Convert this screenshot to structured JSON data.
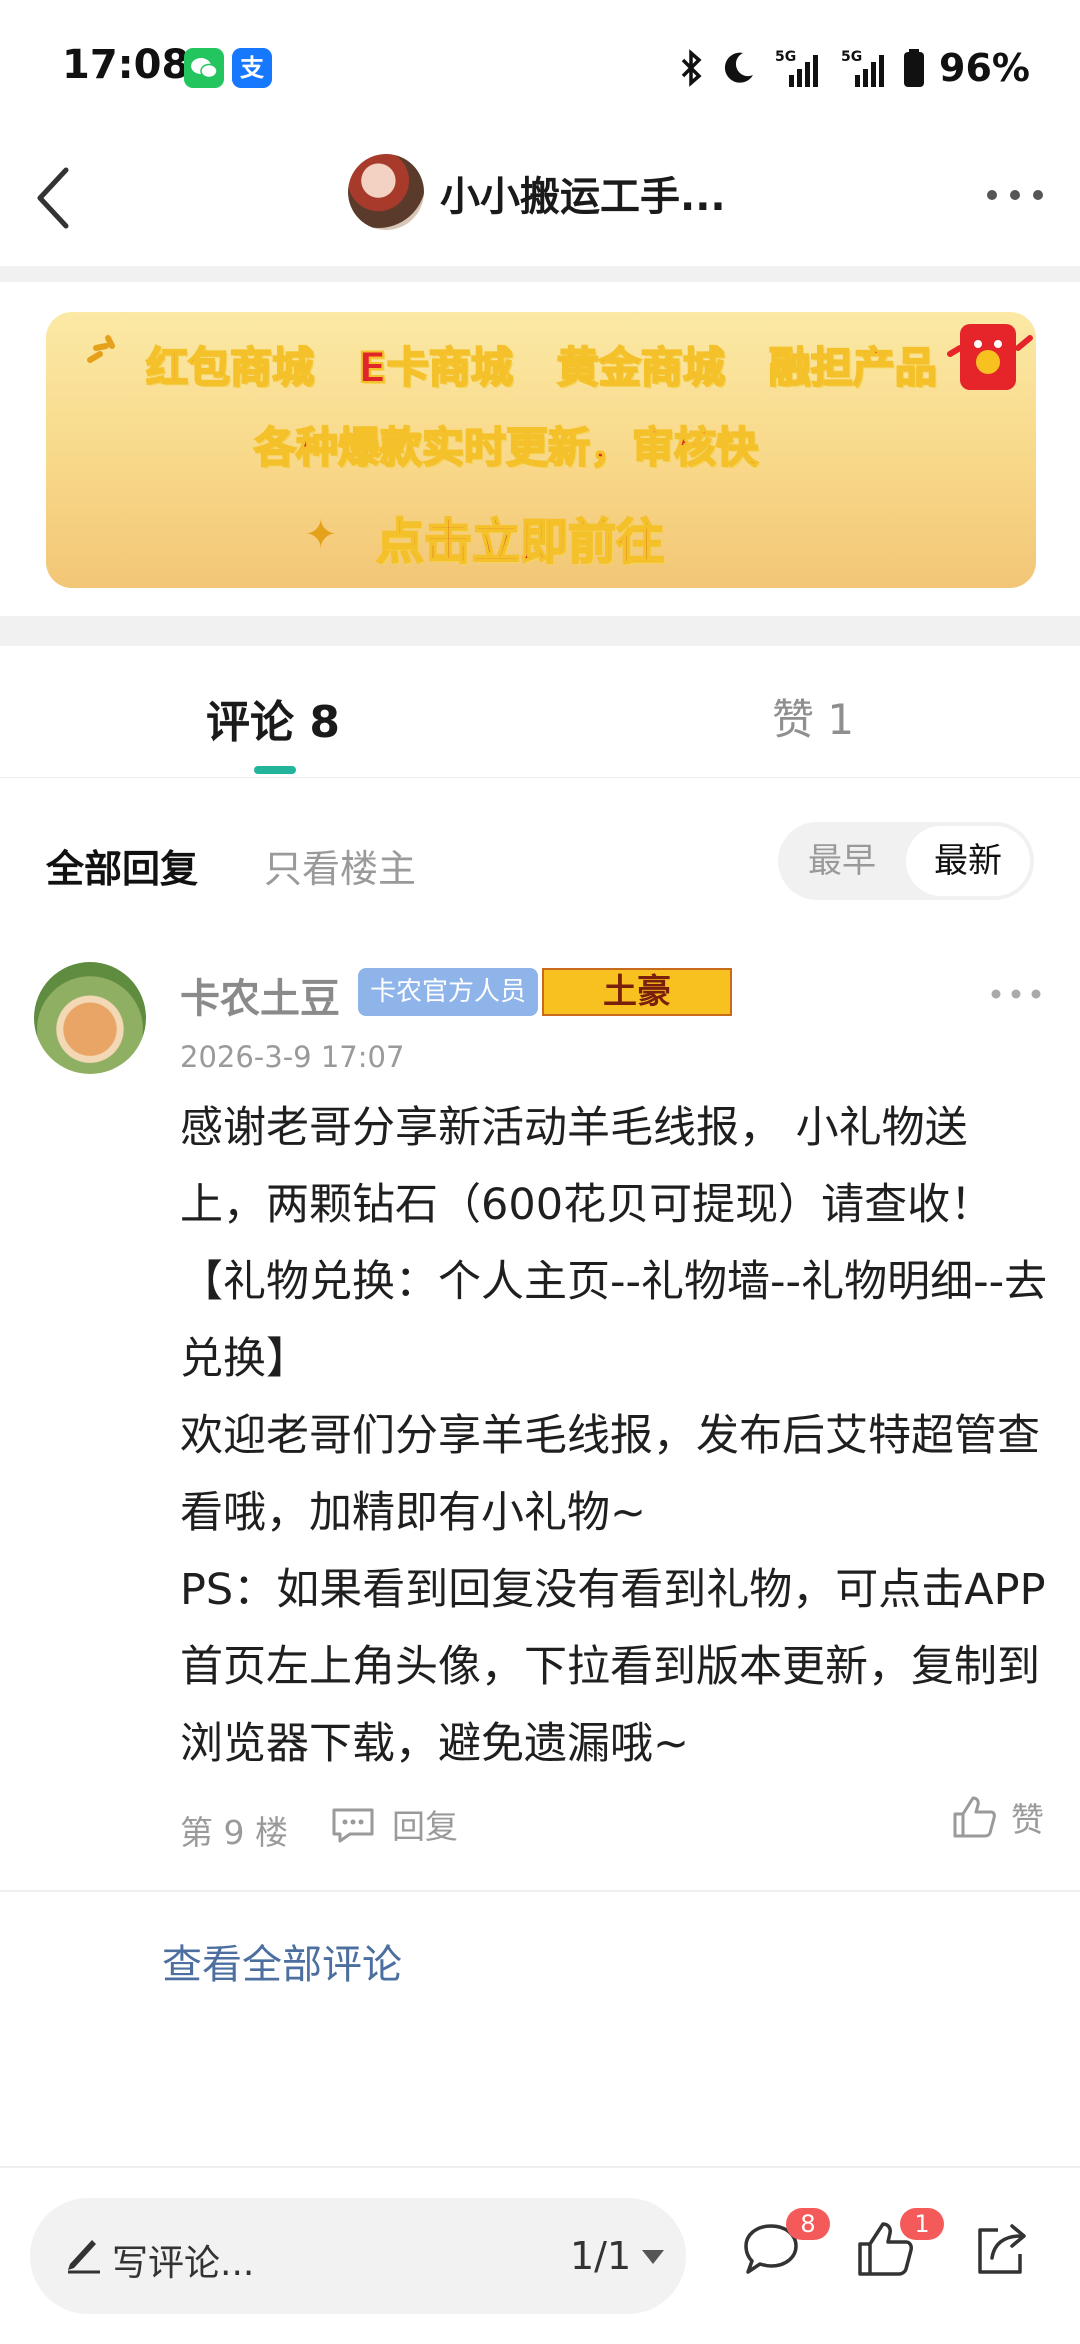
{
  "status_bar": {
    "time": "17:08",
    "battery": "96%",
    "icons": [
      "wechat-icon",
      "alipay-icon",
      "bluetooth-icon",
      "moon-icon",
      "signal-5g-icon",
      "signal-5g-icon",
      "battery-icon"
    ],
    "alipay_label": "支"
  },
  "header": {
    "title": "小小搬运工手...",
    "back_icon": "chevron-left-icon",
    "more_icon": "more-horizontal-icon"
  },
  "banner": {
    "items": [
      "红包商城",
      "E卡商城",
      "黄金商城",
      "融担产品"
    ],
    "line2": "各种爆款实时更新，审核快",
    "cta": "点击立即前往",
    "spark": "✦",
    "colors": {
      "text": "#e0262a",
      "bg": "#f8d889"
    }
  },
  "tabs": {
    "comments": "评论 8",
    "likes": "赞 1",
    "accent": "#22b59c"
  },
  "filter": {
    "all": "全部回复",
    "op_only": "只看楼主",
    "earliest": "最早",
    "newest": "最新"
  },
  "comment": {
    "name": "卡农土豆",
    "badge": "卡农官方人员",
    "medal": "土豪",
    "time": "2026-3-9 17:07",
    "body": [
      "感谢老哥分享新活动羊毛线报， 小礼物送上，两颗钻石（600花贝可提现）请查收！【礼物兑换：个人主页--礼物墙--礼物明细--去兑换】",
      "欢迎老哥们分享羊毛线报，发布后艾特超管查看哦，加精即有小礼物~",
      "PS：如果看到回复没有看到礼物，可点击APP首页左上角头像，下拉看到版本更新，复制到浏览器下载，避免遗漏哦~"
    ],
    "floor": "第 9 楼",
    "reply": "回复",
    "like": "赞"
  },
  "view_all": "查看全部评论",
  "bottom_bar": {
    "write": "写评论...",
    "page": "1/1",
    "comment_count": "8",
    "like_count": "1"
  }
}
